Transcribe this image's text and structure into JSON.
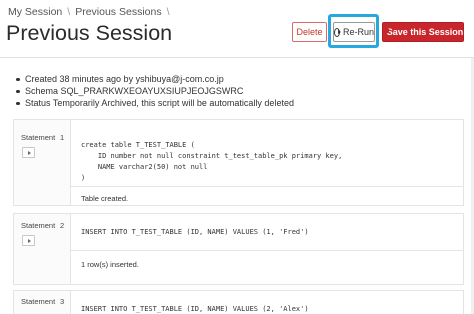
{
  "breadcrumb": {
    "items": [
      "My Session",
      "Previous Sessions"
    ],
    "separator": "\\"
  },
  "page": {
    "title": "Previous Session"
  },
  "toolbar": {
    "delete_label": "Delete",
    "rerun_label": "Re-Run",
    "save_label": "Save this Session",
    "rerun_icon": "play-circle-icon",
    "save_icon": "save-icon",
    "accent_highlight": "#29a8e0",
    "save_color": "#c9252c"
  },
  "info": {
    "created": "Created 38 minutes ago by yshibuya@j-com.co.jp",
    "schema": "Schema SQL_PRARKWXEOAYUXSIUPJEOJGSWRC",
    "status": "Status Temporarily Archived, this script will be automatically deleted"
  },
  "statements": [
    {
      "label": "Statement",
      "number": "1",
      "lines": [
        "create table T_TEST_TABLE (",
        "    ID number not null constraint t_test_table_pk primary key,",
        "    NAME varchar2(50) not null",
        ")"
      ],
      "result": "Table created."
    },
    {
      "label": "Statement",
      "number": "2",
      "lines": [
        "INSERT INTO T_TEST_TABLE (ID, NAME) VALUES (1, 'Fred')"
      ],
      "result": "1 row(s) inserted."
    },
    {
      "label": "Statement",
      "number": "3",
      "lines": [
        "INSERT INTO T_TEST_TABLE (ID, NAME) VALUES (2, 'Alex')"
      ],
      "result": ""
    }
  ]
}
